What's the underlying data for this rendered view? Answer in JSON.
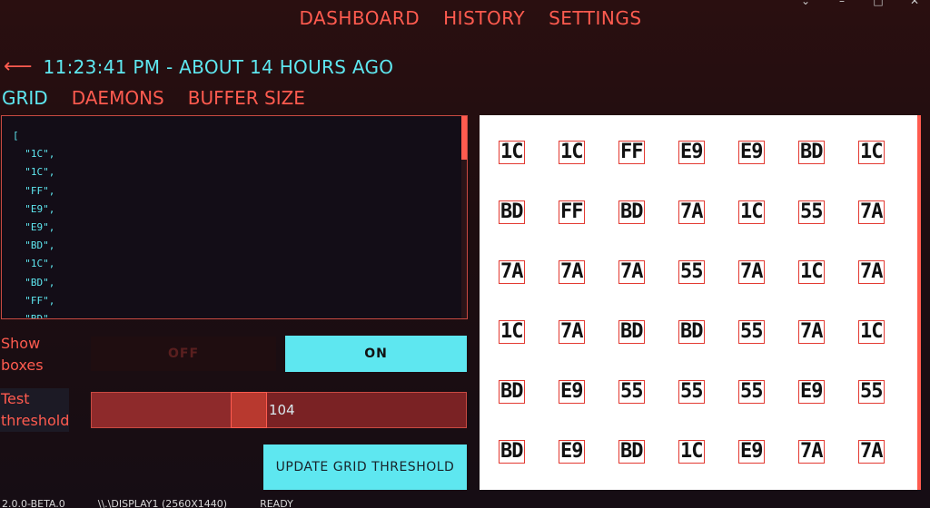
{
  "window_controls": [
    "⌄",
    "–",
    "□",
    "✕"
  ],
  "nav": {
    "items": [
      "DASHBOARD",
      "HISTORY",
      "SETTINGS"
    ]
  },
  "header": {
    "back_icon": "arrow-left-icon",
    "timestamp": "11:23:41 PM - ABOUT 14 HOURS AGO"
  },
  "tabs": [
    {
      "label": "GRID",
      "active": true
    },
    {
      "label": "DAEMONS",
      "active": false
    },
    {
      "label": "BUFFER SIZE",
      "active": false
    }
  ],
  "code_text": "[\n  \"1C\",\n  \"1C\",\n  \"FF\",\n  \"E9\",\n  \"E9\",\n  \"BD\",\n  \"1C\",\n  \"BD\",\n  \"FF\",\n  \"BD\",",
  "show_boxes": {
    "label": "Show\nboxes",
    "off_label": "OFF",
    "on_label": "ON",
    "value": "ON"
  },
  "threshold": {
    "label": "Test\nthreshold",
    "value": "104",
    "min": 0,
    "max": 255
  },
  "update_button": "UPDATE GRID THRESHOLD",
  "grid": [
    [
      "1C",
      "1C",
      "FF",
      "E9",
      "E9",
      "BD",
      "1C"
    ],
    [
      "BD",
      "FF",
      "BD",
      "7A",
      "1C",
      "55",
      "7A"
    ],
    [
      "7A",
      "7A",
      "7A",
      "55",
      "7A",
      "1C",
      "7A"
    ],
    [
      "1C",
      "7A",
      "BD",
      "BD",
      "55",
      "7A",
      "1C"
    ],
    [
      "BD",
      "E9",
      "55",
      "55",
      "55",
      "E9",
      "55"
    ],
    [
      "BD",
      "E9",
      "BD",
      "1C",
      "E9",
      "7A",
      "7A"
    ]
  ],
  "status": {
    "version": "2.0.0-BETA.0",
    "display": "\\\\.\\DISPLAY1 (2560X1440)",
    "state": "READY"
  },
  "colors": {
    "accent_red": "#ff5b4f",
    "accent_cyan": "#5ee7f0"
  }
}
